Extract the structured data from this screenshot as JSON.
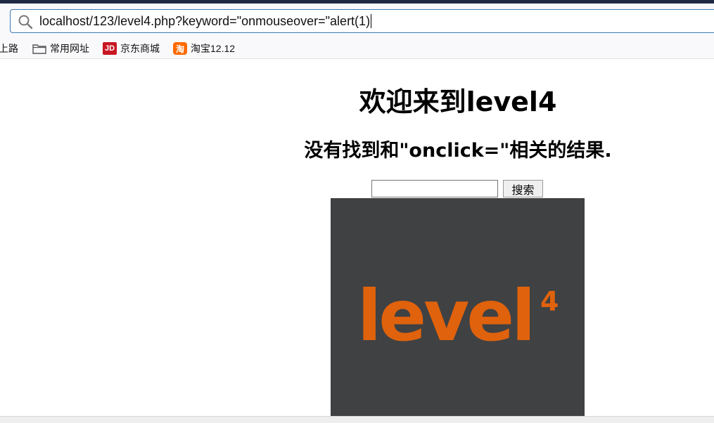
{
  "browser": {
    "url": "localhost/123/level4.php?keyword=\"onmouseover=\"alert(1)",
    "bookmarks": [
      {
        "label": "上路",
        "icon": "none"
      },
      {
        "label": "常用网址",
        "icon": "folder-icon"
      },
      {
        "label": "京东商城",
        "icon": "jd-icon"
      },
      {
        "label": "淘宝12.12",
        "icon": "taobao-icon"
      }
    ],
    "jd_icon_text": "JD",
    "taobao_icon_text": "淘"
  },
  "page": {
    "title": "欢迎来到level4",
    "result_message": "没有找到和\"onclick=\"相关的结果.",
    "search_input_value": "",
    "search_button_label": "搜索",
    "image_logo_text": "level",
    "image_logo_superscript": "4"
  },
  "colors": {
    "accent_url_border": "#3d7ab5",
    "image_bg": "#404143",
    "logo_orange": "#e0620c"
  }
}
